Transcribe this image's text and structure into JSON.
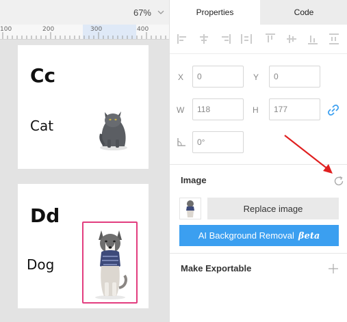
{
  "canvas": {
    "zoom": "67%",
    "ruler_labels": [
      "100",
      "200",
      "300",
      "400"
    ],
    "cards": [
      {
        "title": "Cc",
        "word": "Cat",
        "image_icon": "cat-photo"
      },
      {
        "title": "Dd",
        "word": "Dog",
        "image_icon": "dog-photo"
      }
    ],
    "selection_color": "#e23c7e"
  },
  "tabs": [
    {
      "label": "Properties",
      "active": true
    },
    {
      "label": "Code",
      "active": false
    }
  ],
  "alignment_icons": [
    "align-left-icon",
    "align-center-icon",
    "align-right-icon",
    "distribute-horizontal-icon",
    "align-top-icon",
    "align-middle-icon",
    "align-bottom-icon",
    "distribute-vertical-icon"
  ],
  "properties": {
    "x_label": "X",
    "x_value": "0",
    "y_label": "Y",
    "y_value": "0",
    "w_label": "W",
    "w_value": "118",
    "h_label": "H",
    "h_value": "177",
    "rotation_value": "0°"
  },
  "image_section": {
    "title": "Image",
    "replace_label": "Replace image",
    "ai_label": "AI Background Removal",
    "ai_badge": "βeta",
    "accent_color": "#3b9ff0"
  },
  "export_section": {
    "title": "Make Exportable"
  },
  "annotation": {
    "color": "#e02020"
  }
}
